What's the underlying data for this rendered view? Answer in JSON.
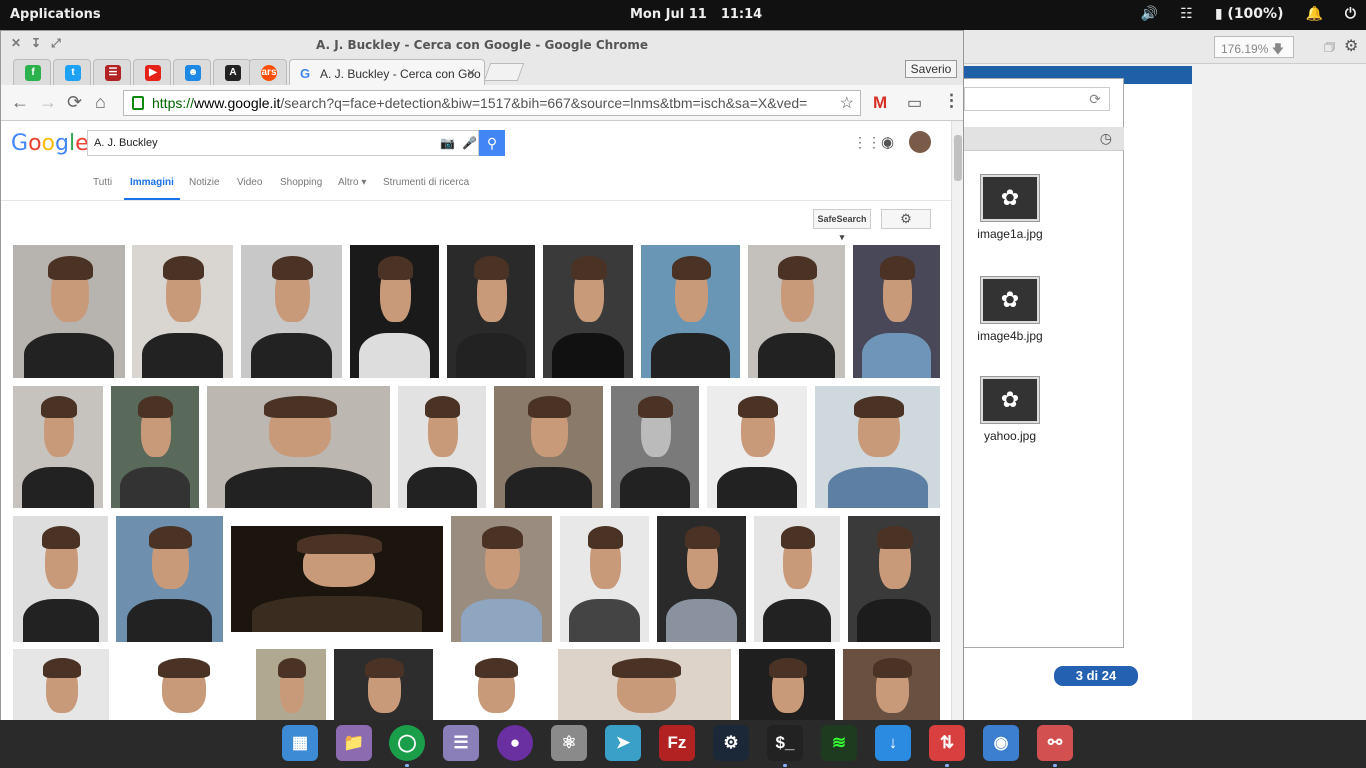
{
  "topbar": {
    "applications": "Applications",
    "date": "Mon Jul 11",
    "time": "11:14",
    "battery": "(100%)"
  },
  "bg": {
    "zoom": "176.19%",
    "page_counter": "3 di 24",
    "files": [
      "image1a.jpg",
      "image4b.jpg",
      "yahoo.jpg"
    ]
  },
  "chrome": {
    "window_title": "A. J. Buckley - Cerca con Google - Google Chrome",
    "active_tab": "A. J. Buckley - Cerca con Goo",
    "profile": "Saverio",
    "url_proto": "https://",
    "url_host": "www.google.it",
    "url_rest": "/search?q=face+detection&biw=1517&bih=667&source=lnms&tbm=isch&sa=X&ved="
  },
  "google": {
    "logo": "Google",
    "query": "A. J. Buckley",
    "tabs": [
      "Tutti",
      "Immagini",
      "Notizie",
      "Video",
      "Shopping",
      "Altro",
      "Strumenti di ricerca"
    ],
    "safesearch": "SafeSearch"
  },
  "colors": {
    "google_blue": "#4285f4",
    "active_tab": "#1a73e8",
    "url_green": "#006400",
    "pager_blue": "#2461b0"
  }
}
